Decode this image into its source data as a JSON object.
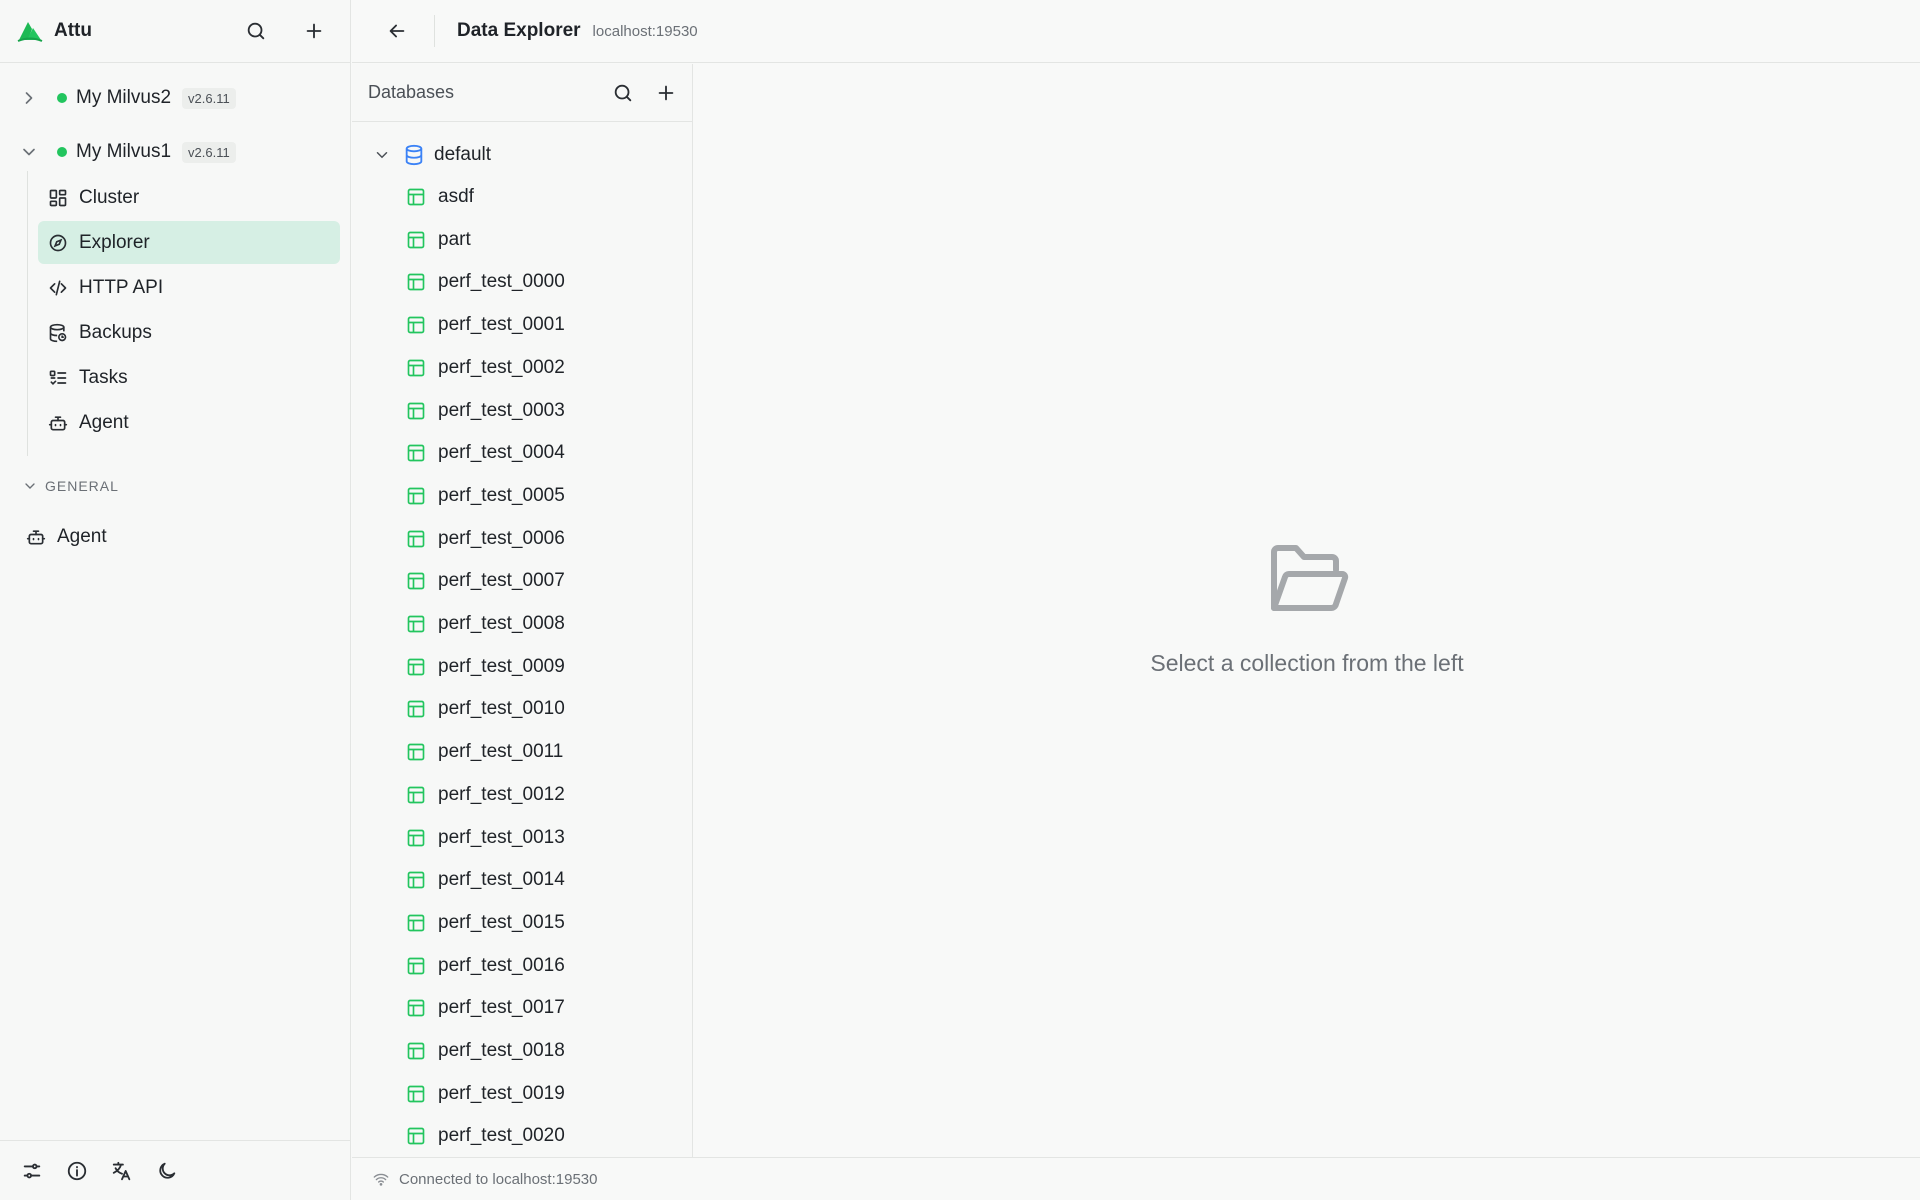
{
  "app": {
    "name": "Attu"
  },
  "sidebar": {
    "connections": [
      {
        "name": "My Milvus2",
        "version": "v2.6.11",
        "expanded": false,
        "status_color": "#22c55e"
      },
      {
        "name": "My Milvus1",
        "version": "v2.6.11",
        "expanded": true,
        "status_color": "#22c55e"
      }
    ],
    "nav_items": [
      {
        "label": "Cluster",
        "icon": "dashboard-icon"
      },
      {
        "label": "Explorer",
        "icon": "compass-icon",
        "active": true
      },
      {
        "label": "HTTP API",
        "icon": "code-icon"
      },
      {
        "label": "Backups",
        "icon": "database-backup-icon"
      },
      {
        "label": "Tasks",
        "icon": "list-checks-icon"
      },
      {
        "label": "Agent",
        "icon": "bot-icon"
      }
    ],
    "general": {
      "label": "GENERAL",
      "items": [
        {
          "label": "Agent",
          "icon": "bot-icon"
        }
      ]
    }
  },
  "topbar": {
    "title": "Data Explorer",
    "host": "localhost:19530"
  },
  "databases": {
    "title": "Databases",
    "database": {
      "name": "default",
      "expanded": true
    },
    "collections": [
      "asdf",
      "part",
      "perf_test_0000",
      "perf_test_0001",
      "perf_test_0002",
      "perf_test_0003",
      "perf_test_0004",
      "perf_test_0005",
      "perf_test_0006",
      "perf_test_0007",
      "perf_test_0008",
      "perf_test_0009",
      "perf_test_0010",
      "perf_test_0011",
      "perf_test_0012",
      "perf_test_0013",
      "perf_test_0014",
      "perf_test_0015",
      "perf_test_0016",
      "perf_test_0017",
      "perf_test_0018",
      "perf_test_0019",
      "perf_test_0020"
    ]
  },
  "main": {
    "empty_message": "Select a collection from the left",
    "empty_icon": "folder-open-icon"
  },
  "statusbar": {
    "text": "Connected to localhost:19530"
  },
  "colors": {
    "accent": "#22c55e",
    "active_bg": "#d6efe4",
    "db_icon": "#3b82f6"
  }
}
